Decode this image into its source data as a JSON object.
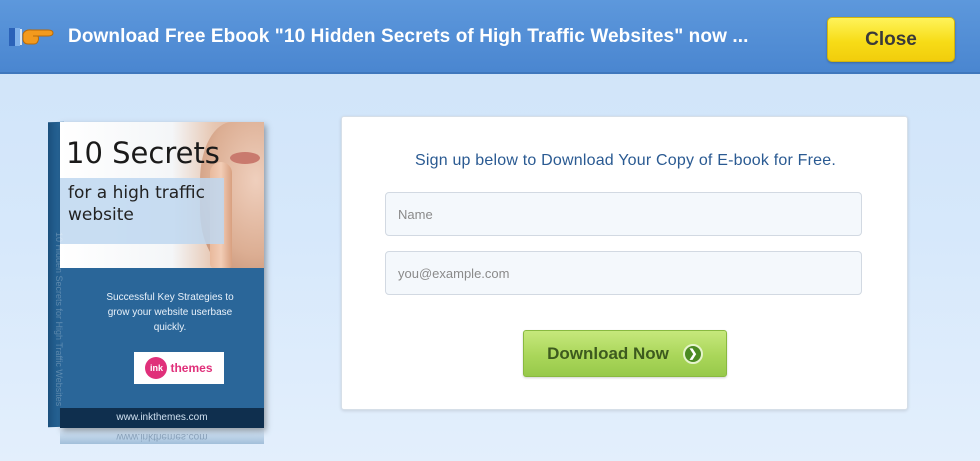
{
  "banner": {
    "headline": "Download Free Ebook \"10 Hidden Secrets of High Traffic Websites\" now ...",
    "close_label": "Close"
  },
  "ebook": {
    "title": "10 Secrets",
    "subtitle": "for a high traffic website",
    "tagline": "Successful Key Strategies to grow your website userbase quickly.",
    "logo_mark": "ink",
    "logo_text": "themes",
    "url": "www.inkthemes.com",
    "spine_text": "10 Hidden Secrets for High Traffic Websites",
    "reflection_url": "www.inkthemes.com"
  },
  "form": {
    "heading": "Sign up below to Download Your Copy of E-book for Free.",
    "name_placeholder": "Name",
    "email_placeholder": "you@example.com",
    "submit_label": "Download Now",
    "submit_icon": "arrow-right-icon"
  },
  "colors": {
    "banner_bg": "#4a86d0",
    "close_button": "#f7dc17",
    "download_button": "#aad65a",
    "heading_text": "#2a5a92"
  }
}
